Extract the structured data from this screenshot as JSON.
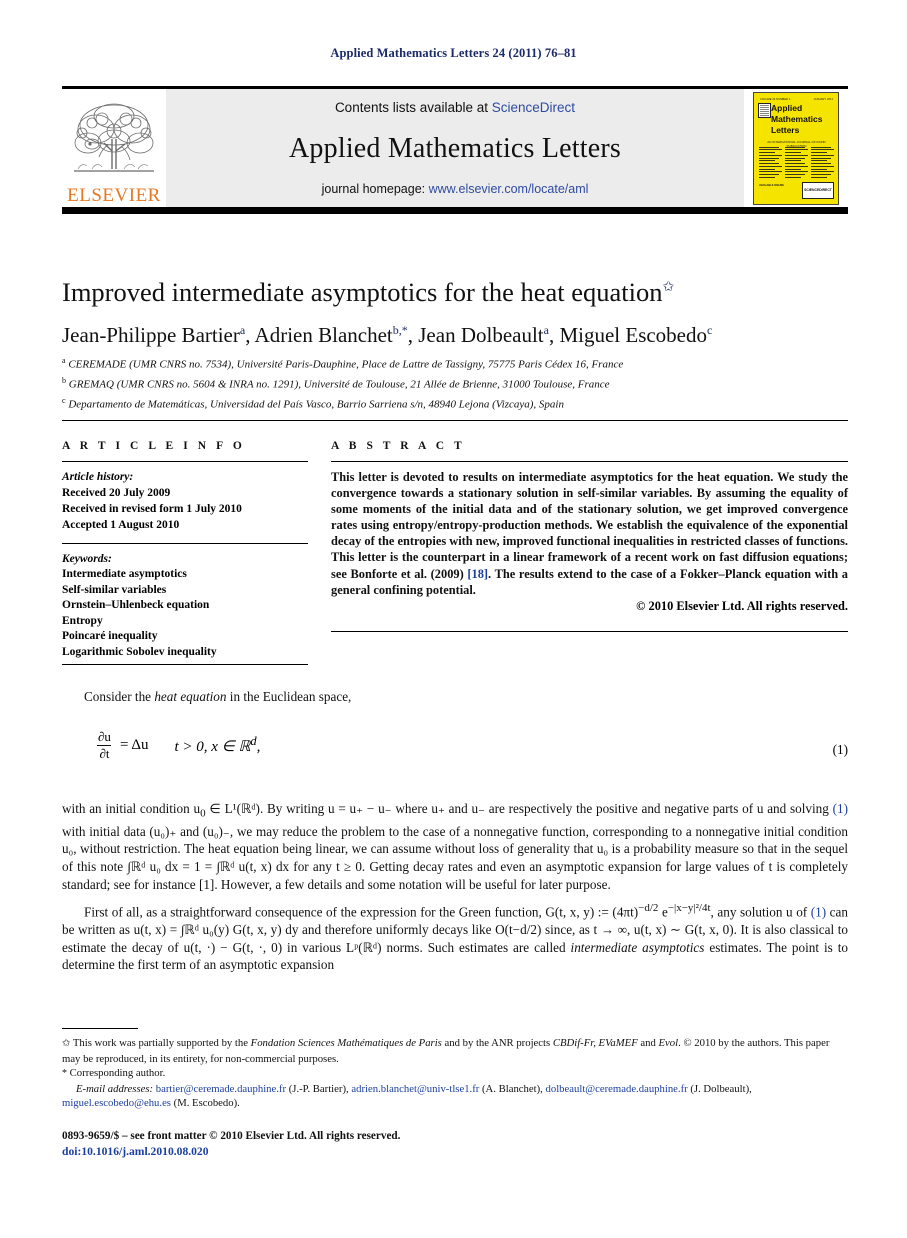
{
  "running_head": "Applied Mathematics Letters 24 (2011) 76–81",
  "masthead": {
    "contents_prefix": "Contents lists available at ",
    "contents_link": "ScienceDirect",
    "journal_title": "Applied Mathematics Letters",
    "homepage_prefix": "journal homepage: ",
    "homepage_link": "www.elsevier.com/locate/aml",
    "publisher_wordmark": "ELSEVIER",
    "cover": {
      "line1": "Applied",
      "line2": "Mathematics",
      "line3": "Letters",
      "top_left_tiny": "VOLUME 24 NUMBER 1",
      "top_right_tiny": "JANUARY 2011",
      "subtitle": "AN INTERNATIONAL JOURNAL OF RAPID PUBLICATION",
      "foot_left": "AVAILABLE ONLINE",
      "foot_right": "SCIENCEDIRECT",
      "background_color": "#f5e300"
    },
    "accent_link_color": "#2f4ba0",
    "elsevier_orange": "#e87722"
  },
  "article": {
    "title": "Improved intermediate asymptotics for the heat equation",
    "title_footnote_marker": "✩",
    "authors": [
      {
        "name": "Jean-Philippe Bartier",
        "marks": "a"
      },
      {
        "name": "Adrien Blanchet",
        "marks": "b,*"
      },
      {
        "name": "Jean Dolbeault",
        "marks": "a"
      },
      {
        "name": "Miguel Escobedo",
        "marks": "c"
      }
    ],
    "affiliations": [
      {
        "mark": "a",
        "text": "CEREMADE (UMR CNRS no. 7534), Université Paris-Dauphine, Place de Lattre de Tassigny, 75775 Paris Cédex 16, France"
      },
      {
        "mark": "b",
        "text": "GREMAQ (UMR CNRS no. 5604 & INRA no. 1291), Université de Toulouse, 21 Allée de Brienne, 31000 Toulouse, France"
      },
      {
        "mark": "c",
        "text": "Departamento de Matemáticas, Universidad del País Vasco, Barrio Sarriena s/n, 48940 Lejona (Vizcaya), Spain"
      }
    ]
  },
  "article_info": {
    "heading": "A R T I C L E   I N F O",
    "history_label": "Article history:",
    "history": [
      "Received 20 July 2009",
      "Received in revised form 1 July 2010",
      "Accepted 1 August 2010"
    ],
    "keywords_label": "Keywords:",
    "keywords": [
      "Intermediate asymptotics",
      "Self-similar variables",
      "Ornstein–Uhlenbeck equation",
      "Entropy",
      "Poincaré inequality",
      "Logarithmic Sobolev inequality"
    ]
  },
  "abstract": {
    "heading": "A B S T R A C T",
    "part1": "This letter is devoted to results on intermediate asymptotics for the heat equation. We study the convergence towards a stationary solution in self-similar variables. By assuming the equality of some moments of the initial data and of the stationary solution, we get improved convergence rates using entropy/entropy-production methods. We establish the equivalence of the exponential decay of the entropies with new, improved functional inequalities in restricted classes of functions. This letter is the counterpart in a linear framework of a recent work on fast diffusion equations; see Bonforte et al. (2009) ",
    "ref": "[18]",
    "part2": ". The results extend to the case of a Fokker–Planck equation with a general confining potential.",
    "copyright": "© 2010 Elsevier Ltd. All rights reserved."
  },
  "body": {
    "lead_pre": "Consider the ",
    "lead_em": "heat equation",
    "lead_post": " in the Euclidean space,",
    "equation": {
      "num_top": "∂u",
      "num_bottom": "∂t",
      "rhs": "= Δu",
      "conditions": "t > 0, x ∈ ℝ",
      "dim": "d",
      "tail": ",",
      "number": "(1)"
    },
    "para2_a": "with an initial condition u",
    "para2_b": " ∈ L¹(ℝᵈ). By writing u = u₊ − u₋ where u₊ and u₋ are respectively the positive and negative parts of u and solving ",
    "para2_link": "(1)",
    "para2_c": " with initial data (u₀)₊ and (u₀)₋, we may reduce the problem to the case of a nonnegative function, corresponding to a nonnegative initial condition u₀, without restriction. The heat equation being linear, we can assume without loss of generality that u₀ is a probability measure so that in the sequel of this note ∫ℝᵈ u₀ dx = 1 = ∫ℝᵈ u(t, x) dx for any t ≥ 0. Getting decay rates and even an asymptotic expansion for large values of t is completely standard; see for instance [1]. However, a few details and some notation will be useful for later purpose.",
    "para3_a": "First of all, as a straightforward consequence of the expression for the Green function, G(t, x, y) := (4πt)",
    "para3_exp": "−d/2",
    "para3_b": " e",
    "para3_c": ", any solution u of ",
    "para3_link": "(1)",
    "para3_d": " can be written as u(t, x) = ∫ℝᵈ u₀(y) G(t, x, y) dy and therefore uniformly decays like O(t−d/2) since, as t → ∞, u(t, x) ∼ G(t, x, 0). It is also classical to estimate the decay of u(t, ·) − G(t, ·, 0) in various Lᵖ(ℝᵈ) norms. Such estimates are called ",
    "para3_em": "intermediate asymptotics",
    "para3_e": " estimates. The point is to determine the first term of an asymptotic expansion"
  },
  "footnotes": {
    "star_mark": "✩",
    "star_a": " This work was partially supported by the ",
    "star_it1": "Fondation Sciences Mathématiques de Paris",
    "star_b": " and by the ANR projects ",
    "star_it2": "CBDif-Fr, EVaMEF",
    "star_c": " and ",
    "star_it3": "Evol",
    "star_d": ". © 2010 by the authors. This paper may be reproduced, in its entirety, for non-commercial purposes.",
    "corresponding_mark": "*",
    "corresponding": " Corresponding author.",
    "email_label": "E-mail addresses:",
    "emails": [
      {
        "address": "bartier@ceremade.dauphine.fr",
        "who": " (J.-P. Bartier), "
      },
      {
        "address": "adrien.blanchet@univ-tlse1.fr",
        "who": " (A. Blanchet), "
      },
      {
        "address": "dolbeault@ceremade.dauphine.fr",
        "who": " (J. Dolbeault), "
      },
      {
        "address": "miguel.escobedo@ehu.es",
        "who": " (M. Escobedo)."
      }
    ]
  },
  "footer": {
    "issn": "0893-9659/$ – see front matter © 2010 Elsevier Ltd. All rights reserved.",
    "doi": "doi:10.1016/j.aml.2010.08.020"
  }
}
